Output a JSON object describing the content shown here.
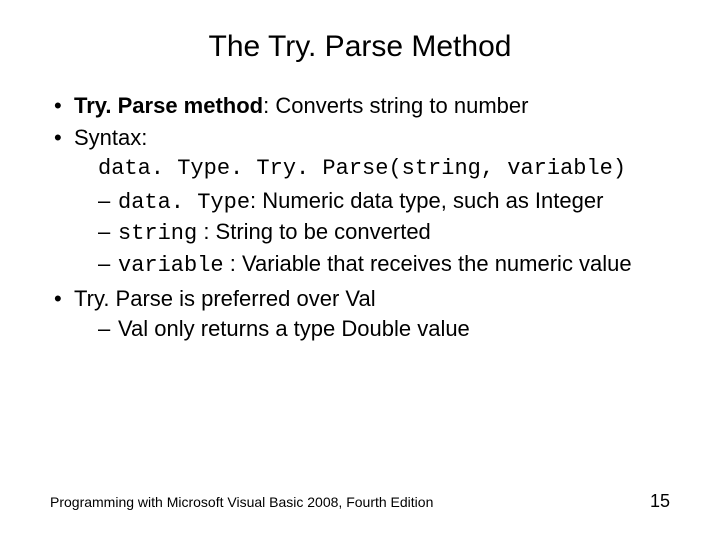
{
  "title": "The Try. Parse Method",
  "bullets": {
    "b1_pre": "Try. Parse method",
    "b1_post": ": Converts string to number",
    "b2": "Syntax:",
    "syntax": "data. Type. Try. Parse(string, variable)",
    "s1_code": "data. Type",
    "s1_post": ": Numeric data type, such as Integer",
    "s2_code": "string",
    "s2_post": " : String to be converted",
    "s3_code": "variable",
    "s3_post": " : Variable that receives the numeric value",
    "b3": "Try. Parse is preferred over Val",
    "b3_sub": "Val only returns a type Double value"
  },
  "footer": {
    "left": "Programming with Microsoft Visual Basic 2008, Fourth Edition",
    "page": "15"
  }
}
